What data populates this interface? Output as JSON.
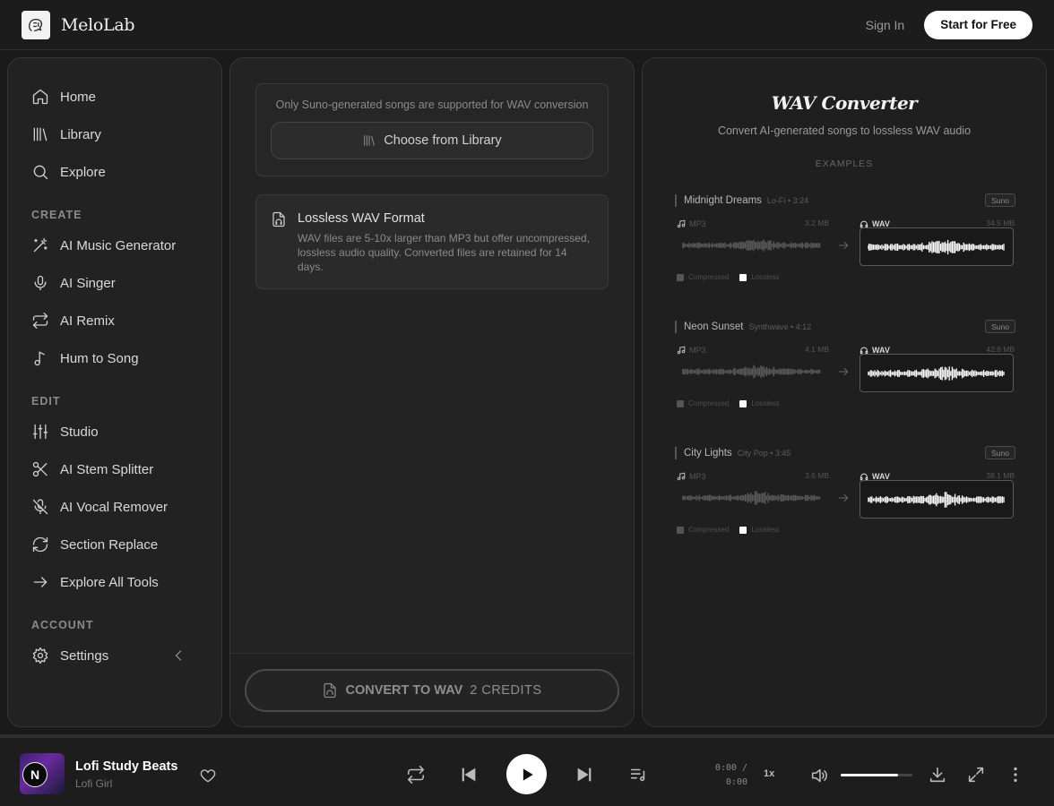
{
  "header": {
    "brand": "MeloLab",
    "sign_in": "Sign In",
    "start_free": "Start for Free"
  },
  "sidebar": {
    "main": [
      {
        "label": "Home",
        "icon": "home-icon"
      },
      {
        "label": "Library",
        "icon": "library-icon"
      },
      {
        "label": "Explore",
        "icon": "search-icon"
      }
    ],
    "create_title": "CREATE",
    "create": [
      {
        "label": "AI Music Generator",
        "icon": "magic-wand-icon"
      },
      {
        "label": "AI Singer",
        "icon": "microphone-icon"
      },
      {
        "label": "AI Remix",
        "icon": "repeat-icon"
      },
      {
        "label": "Hum to Song",
        "icon": "music-note-icon"
      }
    ],
    "edit_title": "EDIT",
    "edit": [
      {
        "label": "Studio",
        "icon": "sliders-icon"
      },
      {
        "label": "AI Stem Splitter",
        "icon": "scissors-icon"
      },
      {
        "label": "AI Vocal Remover",
        "icon": "mic-off-icon"
      },
      {
        "label": "Section Replace",
        "icon": "refresh-icon"
      },
      {
        "label": "Explore All Tools",
        "icon": "arrow-right-icon"
      }
    ],
    "account_title": "ACCOUNT",
    "account": [
      {
        "label": "Settings",
        "icon": "gear-icon"
      }
    ]
  },
  "converter": {
    "upload_note": "Only Suno-generated songs are supported for WAV conversion",
    "choose_label": "Choose from Library",
    "info_title": "Lossless WAV Format",
    "info_text": "WAV files are 5-10x larger than MP3 but offer uncompressed, lossless audio quality. Converted files are retained for 14 days.",
    "convert_label": "CONVERT TO WAV",
    "credits_label": "2 CREDITS"
  },
  "panel": {
    "title": "WAV Converter",
    "subtitle": "Convert AI-generated songs to lossless WAV audio",
    "examples_label": "EXAMPLES",
    "mp3_label": "MP3",
    "wav_label": "WAV",
    "legend_compressed": "Compressed",
    "legend_lossless": "Lossless",
    "examples": [
      {
        "name": "Midnight Dreams",
        "meta": "Lo-Fi • 3:24",
        "badge": "Suno",
        "mp3_size": "3.2 MB",
        "wav_size": "34.5 MB"
      },
      {
        "name": "Neon Sunset",
        "meta": "Synthwave • 4:12",
        "badge": "Suno",
        "mp3_size": "4.1 MB",
        "wav_size": "42.8 MB"
      },
      {
        "name": "City Lights",
        "meta": "City Pop • 3:45",
        "badge": "Suno",
        "mp3_size": "3.6 MB",
        "wav_size": "38.1 MB"
      }
    ]
  },
  "player": {
    "cover_letter": "N",
    "title": "Lofi Study Beats",
    "artist": "Lofi Girl",
    "time_current": "0:00 /",
    "time_total": "0:00",
    "speed": "1x",
    "volume": 0.8
  },
  "colors": {
    "background": "#1a1a1a",
    "panel": "#232323",
    "accent": "#ffffff",
    "muted_text": "#8a8a8a"
  }
}
